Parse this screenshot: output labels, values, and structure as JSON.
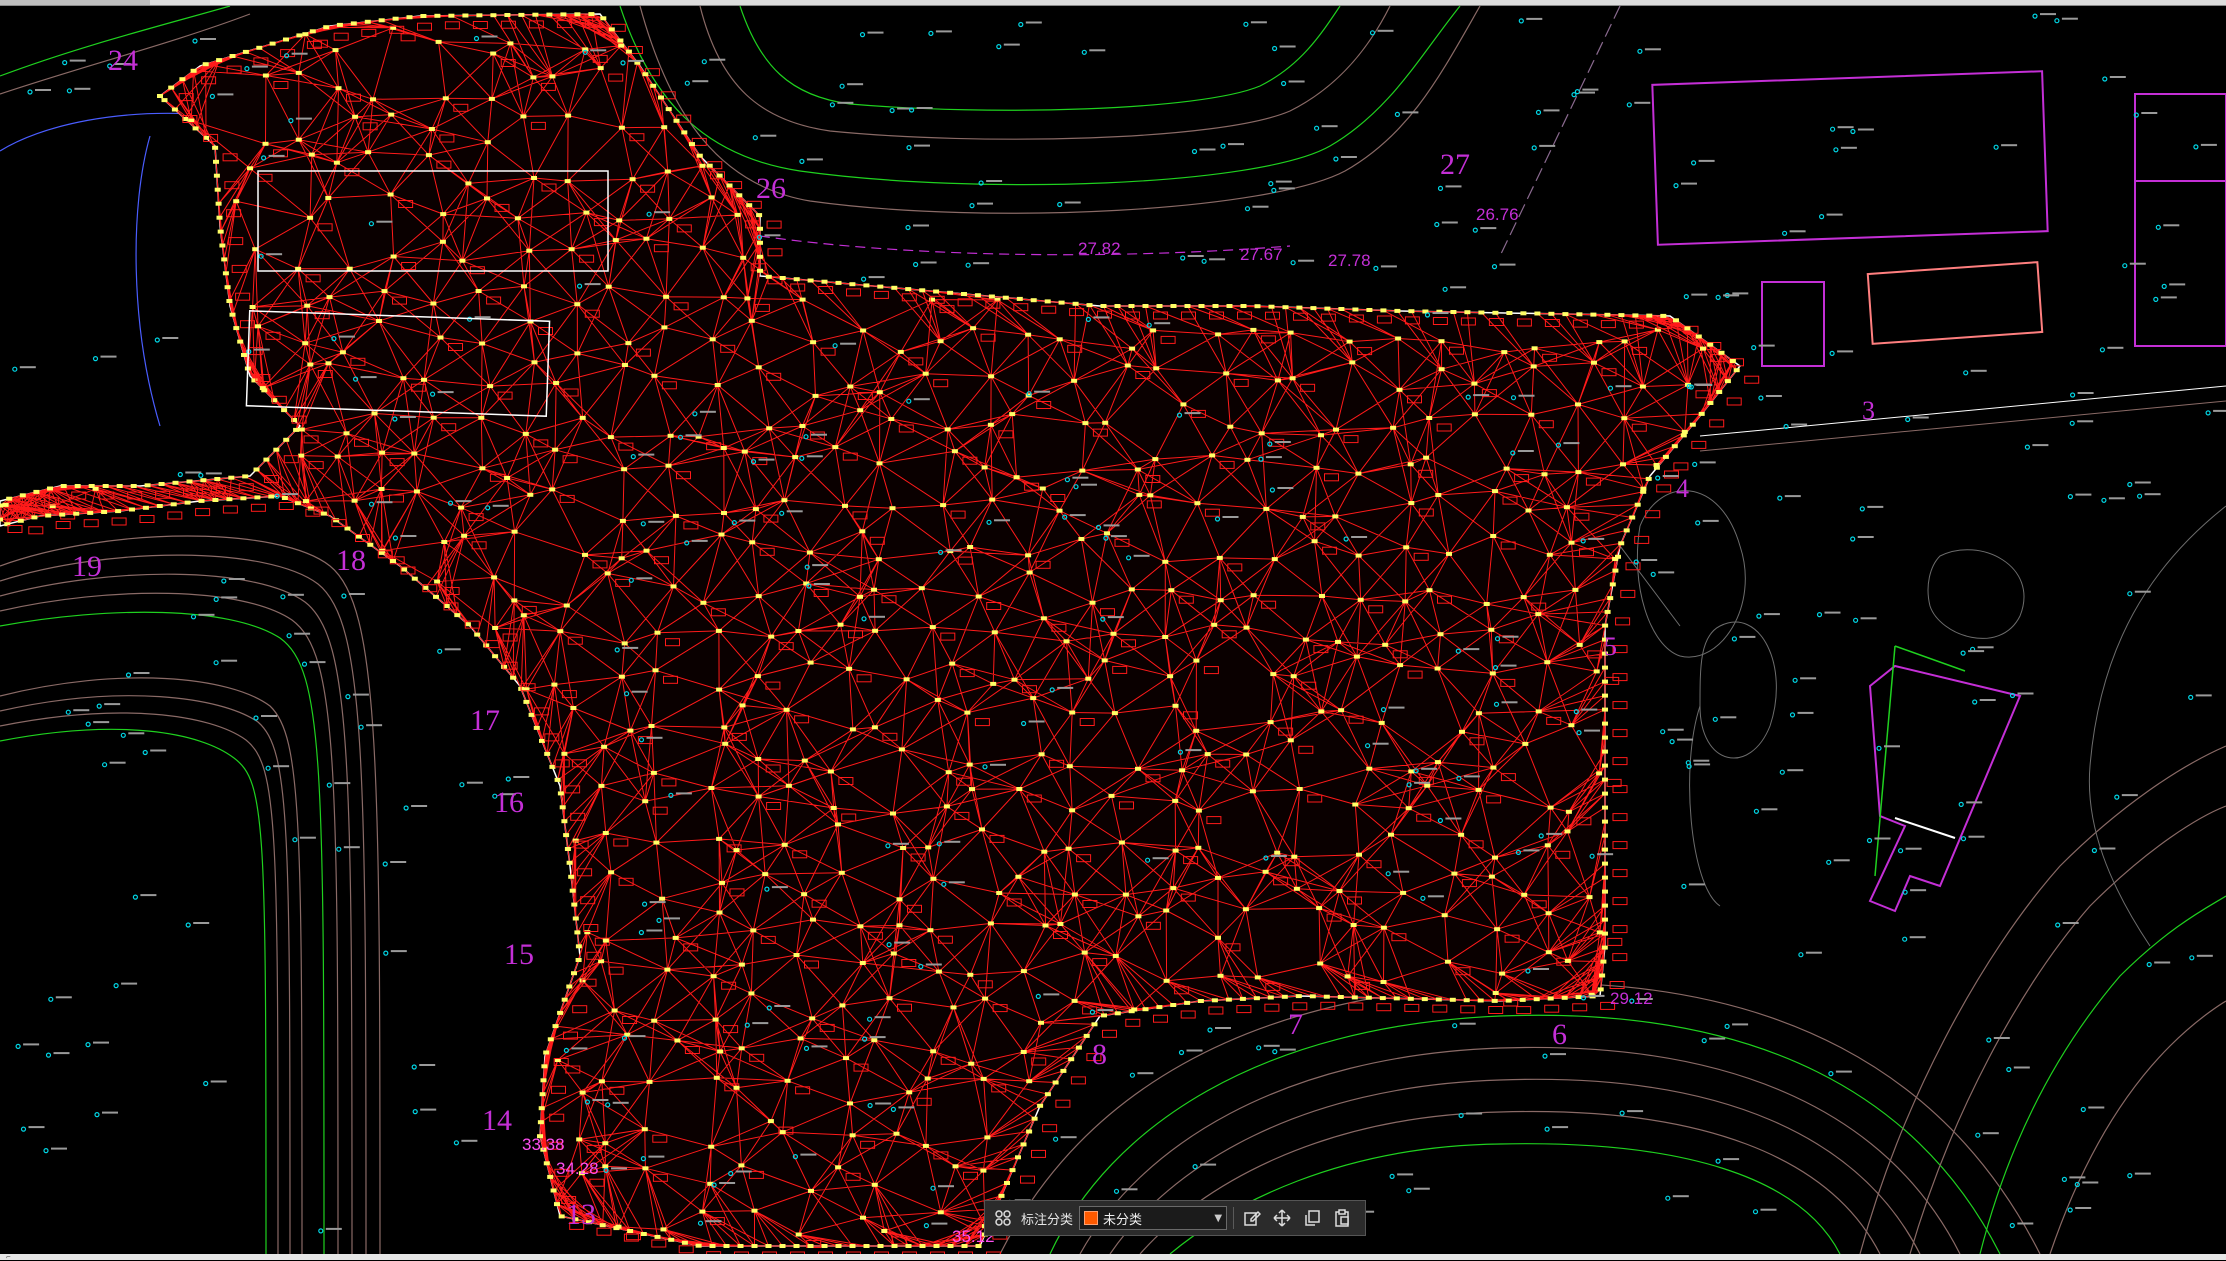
{
  "toolbar": {
    "label": "标注分类",
    "selected": "未分类",
    "selected_color": "#ff5a00",
    "icons": [
      "grid-view-icon",
      "edit-icon",
      "move-icon",
      "copy-icon",
      "paste-icon",
      "chevron-down-icon"
    ]
  },
  "drawing": {
    "colors": {
      "background": "#000000",
      "tin_edges": "#ff1a1a",
      "survey_points": "#ffff66",
      "section_labels": "#c42fd6",
      "contour_major": "#1fd11f",
      "contour_minor": "#8a6a66",
      "boundary": "#ffffff",
      "buildings": "#c42fd6",
      "spot_heights": "#00d7e6"
    },
    "section_labels": [
      "24",
      "26",
      "27",
      "3",
      "4",
      "5",
      "6",
      "7",
      "8",
      "13",
      "14",
      "15",
      "16",
      "17",
      "18",
      "19"
    ],
    "elevation_labels": [
      "26.76",
      "27.82",
      "27.67",
      "27.78",
      "29.12",
      "33.38",
      "34.28",
      "35.12"
    ]
  }
}
